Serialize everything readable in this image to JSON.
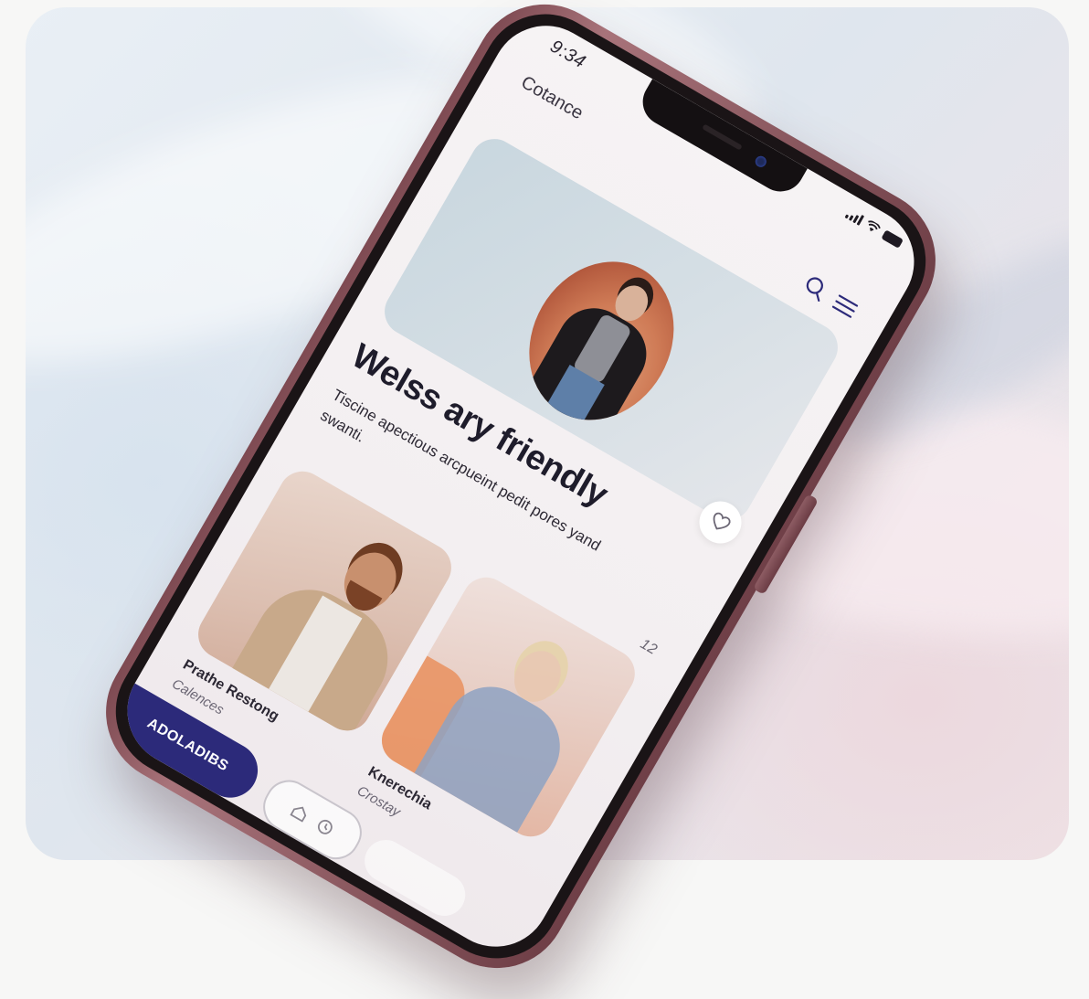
{
  "status_bar": {
    "time": "9:34"
  },
  "header": {
    "app_title": "Cotance"
  },
  "hero": {
    "headline": "Welss ary friendly",
    "subtext": "Tiscine apectious arcpueint pedit pores yand swanti."
  },
  "side_number": "12",
  "cards": [
    {
      "title": "Prathe Restong",
      "subtitle": "Calences"
    },
    {
      "title": "Knerechia",
      "subtitle": "Crostay"
    }
  ],
  "cta": {
    "label": "ADOLADIBS"
  },
  "icons": {
    "search": "search-icon",
    "menu": "hamburger-menu-icon",
    "like": "heart-icon",
    "signal": "signal-icon",
    "wifi": "wifi-icon",
    "battery": "battery-icon"
  },
  "colors": {
    "accent": "#2c2a7a",
    "phone_frame": "#8b5960",
    "text_primary": "#1e1c2b"
  }
}
